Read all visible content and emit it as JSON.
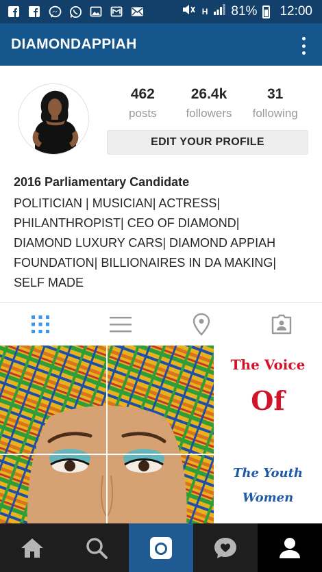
{
  "status_bar": {
    "battery": "81%",
    "time": "12:00",
    "network": "H",
    "icons": [
      "facebook-icon",
      "facebook-icon",
      "messenger-icon",
      "whatsapp-icon",
      "gallery-icon",
      "gallery-icon",
      "email-icon"
    ]
  },
  "header": {
    "username": "DIAMONDAPPIAH"
  },
  "profile": {
    "posts_count": "462",
    "posts_label": "posts",
    "followers_count": "26.4k",
    "followers_label": "followers",
    "following_count": "31",
    "following_label": "following",
    "edit_button": "EDIT YOUR PROFILE"
  },
  "bio": {
    "name": "2016 Parliamentary Candidate",
    "lines": [
      "POLITICIAN | MUSICIAN| ACTRESS|",
      "PHILANTHROPIST| CEO OF DIAMOND|",
      "DIAMOND LUXURY CARS| DIAMOND APPIAH",
      "FOUNDATION| BILLIONAIRES IN DA MAKING|",
      "SELF MADE"
    ]
  },
  "tabs": [
    "grid-icon",
    "list-icon",
    "location-pin-icon",
    "tagged-photos-icon"
  ],
  "grid_post": {
    "line1": "The Voice",
    "line2": "Of",
    "line3": "The Youth",
    "line4": "Women"
  },
  "colors": {
    "status_bar": "#13406b",
    "app_bar": "#14558c",
    "active_tab": "#3897f0",
    "nav_bg": "#1e1e1e",
    "nav_active": "#1f5a93",
    "red_text": "#d0152a",
    "blue_text": "#1f5aa8"
  },
  "bottom_nav": [
    "home-icon",
    "search-icon",
    "camera-icon",
    "activity-heart-icon",
    "profile-icon"
  ]
}
